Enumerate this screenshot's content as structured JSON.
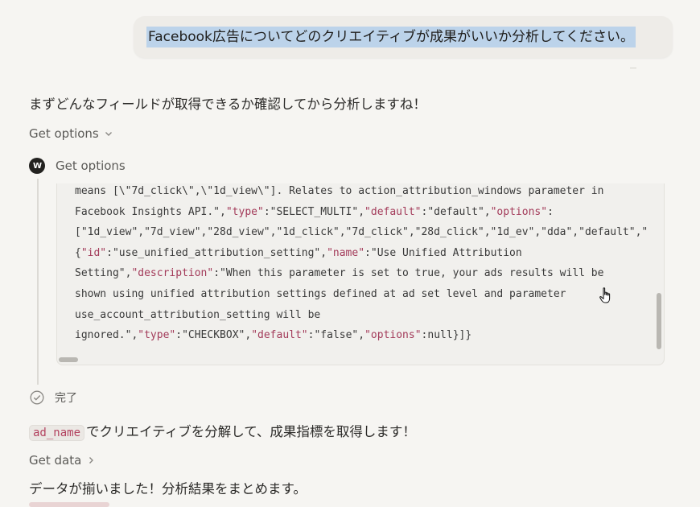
{
  "user_message": "Facebook広告についてどのクリエイティブが成果がいいか分析してください。",
  "assistant": {
    "intro": "まずどんなフィールドが取得できるか確認してから分析しますね！",
    "get_options_toggle": "Get options",
    "tool_call": {
      "label": "Get options",
      "logo_text": "W",
      "code_lines": [
        [
          {
            "t": "means [\\\"7d_click\\\",\\\"1d_view\\\"]. Relates to action_attribution_windows parameter in",
            "c": "v"
          }
        ],
        [
          {
            "t": "Facebook Insights API.\",",
            "c": "v"
          },
          {
            "t": "\"type\"",
            "c": "k"
          },
          {
            "t": ":",
            "c": "p"
          },
          {
            "t": "\"SELECT_MULTI\"",
            "c": "v"
          },
          {
            "t": ",",
            "c": "p"
          },
          {
            "t": "\"default\"",
            "c": "k"
          },
          {
            "t": ":",
            "c": "p"
          },
          {
            "t": "\"default\"",
            "c": "v"
          },
          {
            "t": ",",
            "c": "p"
          },
          {
            "t": "\"options\"",
            "c": "k"
          },
          {
            "t": ":",
            "c": "p"
          }
        ],
        [
          {
            "t": "[\"1d_view\",\"7d_view\",\"28d_view\",\"1d_click\",\"7d_click\",\"28d_click\",\"1d_ev\",\"dda\",\"default\",\"",
            "c": "v"
          }
        ],
        [
          {
            "t": "{",
            "c": "p"
          },
          {
            "t": "\"id\"",
            "c": "k"
          },
          {
            "t": ":",
            "c": "p"
          },
          {
            "t": "\"use_unified_attribution_setting\"",
            "c": "v"
          },
          {
            "t": ",",
            "c": "p"
          },
          {
            "t": "\"name\"",
            "c": "k"
          },
          {
            "t": ":",
            "c": "p"
          },
          {
            "t": "\"Use Unified Attribution",
            "c": "v"
          }
        ],
        [
          {
            "t": "Setting\"",
            "c": "v"
          },
          {
            "t": ",",
            "c": "p"
          },
          {
            "t": "\"description\"",
            "c": "k"
          },
          {
            "t": ":",
            "c": "p"
          },
          {
            "t": "\"When this parameter is set to true, your ads results will be",
            "c": "v"
          }
        ],
        [
          {
            "t": "shown using unified attribution settings defined at ad set level and parameter",
            "c": "v"
          }
        ],
        [
          {
            "t": "use_account_attribution_setting will be",
            "c": "v"
          }
        ],
        [
          {
            "t": "ignored.\"",
            "c": "v"
          },
          {
            "t": ",",
            "c": "p"
          },
          {
            "t": "\"type\"",
            "c": "k"
          },
          {
            "t": ":",
            "c": "p"
          },
          {
            "t": "\"CHECKBOX\"",
            "c": "v"
          },
          {
            "t": ",",
            "c": "p"
          },
          {
            "t": "\"default\"",
            "c": "k"
          },
          {
            "t": ":",
            "c": "p"
          },
          {
            "t": "\"false\"",
            "c": "v"
          },
          {
            "t": ",",
            "c": "p"
          },
          {
            "t": "\"options\"",
            "c": "k"
          },
          {
            "t": ":",
            "c": "p"
          },
          {
            "t": "null",
            "c": "v"
          },
          {
            "t": "}]}",
            "c": "p"
          }
        ]
      ]
    },
    "done_label": "完了",
    "decompose_code": "ad_name",
    "decompose_text": "でクリエイティブを分解して、成果指標を取得します！",
    "get_data_toggle": "Get data",
    "summary": "データが揃いました！分析結果をまとめます。"
  },
  "colors": {
    "background": "#f6f5f2",
    "selection": "#bcd3ea",
    "code_key": "#a33b5a",
    "inline_code": "#b3425f"
  },
  "icons": {
    "chevron_down": "chevron-down-icon",
    "chevron_right": "chevron-right-icon",
    "check": "check-circle-icon",
    "cursor": "hand-pointer-icon"
  }
}
